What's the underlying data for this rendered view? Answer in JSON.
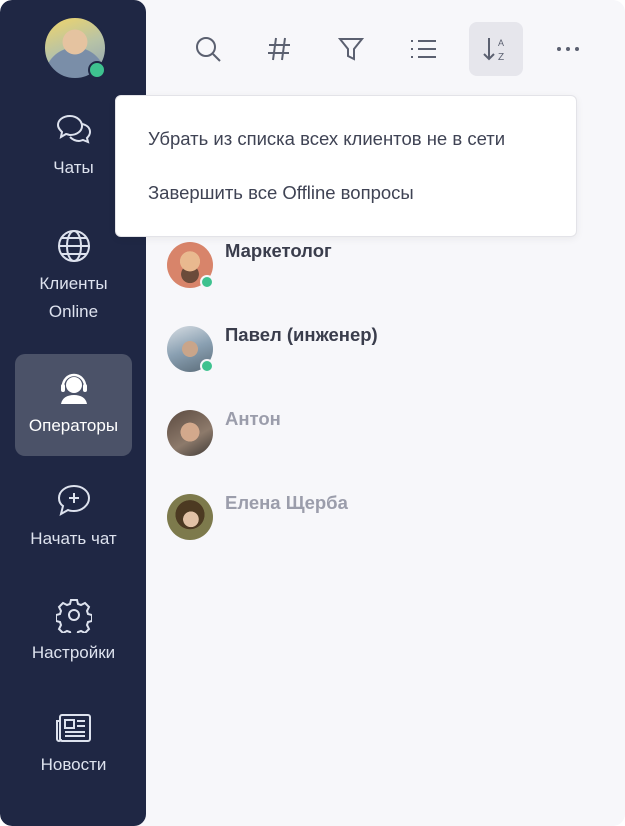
{
  "sidebar": {
    "user_status": "online",
    "items": [
      {
        "label": "Чаты",
        "icon": "chat-bubbles-icon",
        "active": false
      },
      {
        "label": "Клиенты Online",
        "icon": "globe-icon",
        "active": false
      },
      {
        "label": "Операторы",
        "icon": "operator-headset-icon",
        "active": true
      },
      {
        "label": "Начать чат",
        "icon": "new-chat-icon",
        "active": false
      },
      {
        "label": "Настройки",
        "icon": "gear-icon",
        "active": false
      },
      {
        "label": "Новости",
        "icon": "newspaper-icon",
        "active": false
      }
    ]
  },
  "toolbar": {
    "tools": [
      {
        "icon": "search-icon"
      },
      {
        "icon": "hashtag-icon"
      },
      {
        "icon": "filter-icon"
      },
      {
        "icon": "list-icon"
      },
      {
        "icon": "sort-az-icon",
        "active": true
      },
      {
        "icon": "more-icon"
      }
    ]
  },
  "dropdown": {
    "items": [
      "Убрать из списка всех клиентов не в сети",
      "Завершить все Offline вопросы"
    ]
  },
  "operators": [
    {
      "name": "Маркетолог",
      "status": "online"
    },
    {
      "name": "Павел (инженер)",
      "status": "online"
    },
    {
      "name": "Антон",
      "status": "offline"
    },
    {
      "name": "Елена Щерба",
      "status": "offline"
    }
  ],
  "colors": {
    "sidebar_bg": "#1f2744",
    "active_item_bg": "#4b5268",
    "online_status": "#3ec28f",
    "background": "#f7f7fa"
  }
}
